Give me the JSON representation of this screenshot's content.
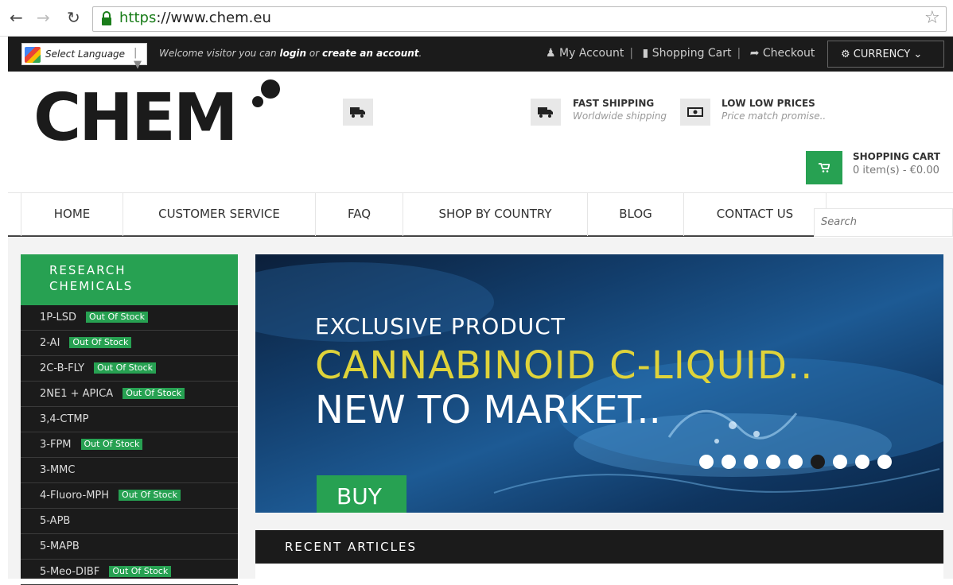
{
  "browser": {
    "url_scheme": "https",
    "url_rest": "://www.chem.eu"
  },
  "topbar": {
    "language_label": "Select Language",
    "welcome_prefix": "Welcome visitor you can ",
    "login": "login",
    "or": " or ",
    "create_account": "create an account",
    "period": ".",
    "my_account": "My Account",
    "shopping_cart": "Shopping Cart",
    "checkout": "Checkout",
    "currency": "CURRENCY"
  },
  "header": {
    "logo_text": "CHEM",
    "features": [
      {
        "title": "FAST SHIPPING",
        "subtitle": "Worldwide shipping"
      },
      {
        "title": "LOW LOW PRICES",
        "subtitle": "Price match promise.."
      }
    ],
    "cart_title": "SHOPPING CART",
    "cart_summary": "0 item(s) - €0.00"
  },
  "nav": {
    "items": [
      "HOME",
      "CUSTOMER SERVICE",
      "FAQ",
      "SHOP BY COUNTRY",
      "BLOG",
      "CONTACT US"
    ],
    "search_placeholder": "Search"
  },
  "sidebar": {
    "heading_line1": "RESEARCH",
    "heading_line2": "CHEMICALS",
    "badge_text": "Out Of Stock",
    "items": [
      {
        "label": "1P-LSD",
        "out_of_stock": true
      },
      {
        "label": "2-AI",
        "out_of_stock": true
      },
      {
        "label": "2C-B-FLY",
        "out_of_stock": true
      },
      {
        "label": "2NE1 + APICA",
        "out_of_stock": true
      },
      {
        "label": "3,4-CTMP",
        "out_of_stock": false
      },
      {
        "label": "3-FPM",
        "out_of_stock": true
      },
      {
        "label": "3-MMC",
        "out_of_stock": false
      },
      {
        "label": "4-Fluoro-MPH",
        "out_of_stock": true
      },
      {
        "label": "5-APB",
        "out_of_stock": false
      },
      {
        "label": "5-MAPB",
        "out_of_stock": false
      },
      {
        "label": "5-Meo-DIBF",
        "out_of_stock": true
      }
    ]
  },
  "banner": {
    "line1": "EXCLUSIVE PRODUCT",
    "line2": "CANNABINOID C-LIQUID..",
    "line3": "NEW TO MARKET..",
    "buy": "BUY",
    "slide_count": 9,
    "active_slide": 6
  },
  "articles": {
    "heading": "RECENT ARTICLES"
  },
  "colors": {
    "accent_green": "#27a152",
    "dark": "#1b1b1b",
    "banner_yellow": "#dfd33a"
  },
  "icons": [
    "back-arrow-icon",
    "forward-arrow-icon",
    "reload-icon",
    "lock-icon",
    "star-icon",
    "google-translate-icon",
    "user-icon",
    "bookmark-icon",
    "share-arrow-icon",
    "gear-icon",
    "chevron-down-icon",
    "truck-icon",
    "money-icon",
    "cart-icon"
  ]
}
